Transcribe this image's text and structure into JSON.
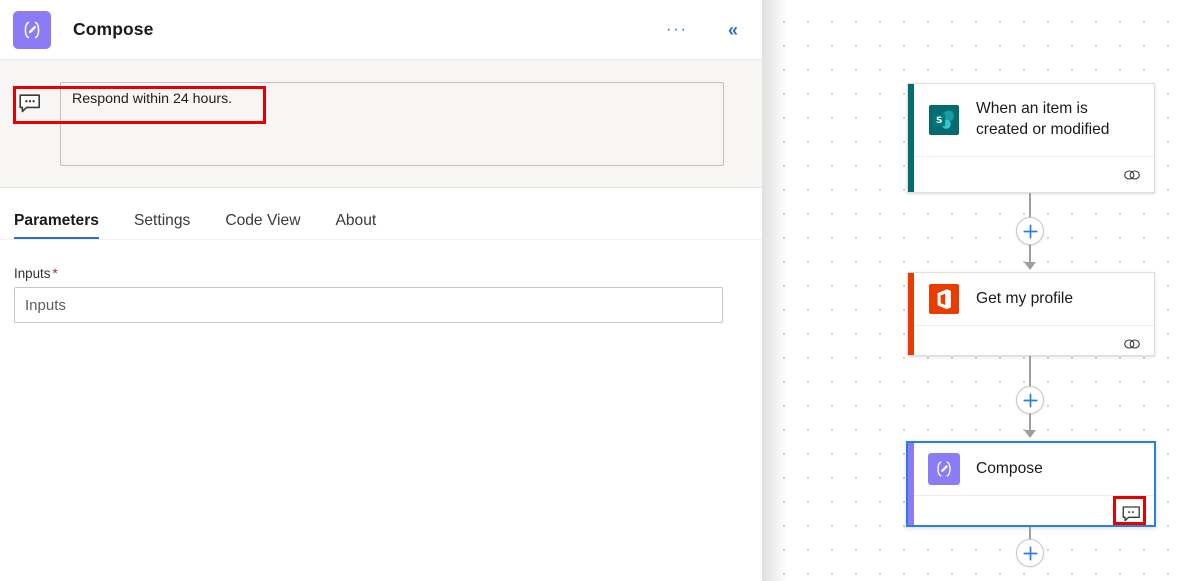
{
  "panel": {
    "app_icon_name": "compose-app-icon",
    "title": "Compose",
    "more_label": "···",
    "collapse_label": "«",
    "accent_blue": "#2a6fc9",
    "app_icon_color": "#8b7cf6"
  },
  "comment": {
    "icon_name": "comment-icon",
    "text": "Respond within 24 hours.",
    "highlight_color": "#e60000"
  },
  "tabs": [
    {
      "label": "Parameters",
      "active": true
    },
    {
      "label": "Settings",
      "active": false
    },
    {
      "label": "Code View",
      "active": false
    },
    {
      "label": "About",
      "active": false
    }
  ],
  "parameters": {
    "inputs_label": "Inputs",
    "required_marker": "*",
    "inputs_value": "",
    "inputs_placeholder": "Inputs"
  },
  "canvas": {
    "grid": "dotted",
    "nodes": [
      {
        "id": "trigger",
        "title": "When an item is created or modified",
        "icon_name": "sharepoint-icon",
        "accent_color": "#036c70",
        "selected": false,
        "footer_icon": "link-icon"
      },
      {
        "id": "get-my-profile",
        "title": "Get my profile",
        "icon_name": "office365-icon",
        "accent_color": "#eb3c00",
        "selected": false,
        "footer_icon": "link-icon"
      },
      {
        "id": "compose",
        "title": "Compose",
        "icon_name": "compose-icon",
        "accent_color": "#8b7cf6",
        "selected": true,
        "footer_icon": "comment-icon",
        "footer_icon_highlighted": true
      }
    ],
    "add_buttons": [
      {
        "name": "add-step-1",
        "label": "+"
      },
      {
        "name": "add-step-2",
        "label": "+"
      },
      {
        "name": "add-step-3",
        "label": "+"
      }
    ]
  }
}
